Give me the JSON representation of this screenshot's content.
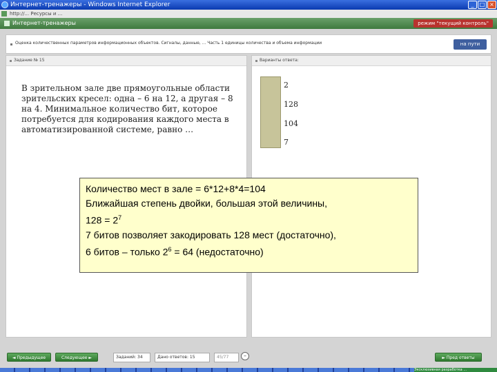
{
  "window": {
    "title": "Интернет-тренажеры - Windows Internet Explorer"
  },
  "address": {
    "url": "http://... Ресурсы и ..."
  },
  "app": {
    "name": "Интернет-тренажеры",
    "mode_label": "режим \"текущий контроль\""
  },
  "topic": {
    "text": "Оценка количественных параметров информационных объектов. Сигналы, данные, ... Часть 1 единицы количества и объема информации",
    "back_label": "на пути"
  },
  "question_panel": {
    "header": "Задание № 15",
    "text": "В зрительном зале две прямоугольные области зрительских кресел: одна – 6 на 12, а другая – 8 на 4. Минимальное количество бит, которое потребуется для кодирования каждого места в автоматизированной системе, равно …"
  },
  "answer_panel": {
    "header": "Варианты ответа:",
    "options": [
      "2",
      "128",
      "104",
      "7"
    ]
  },
  "explanation": {
    "line1": "Количество мест в зале = 6*12+8*4=104",
    "line2": "Ближайшая степень двойки, большая этой величины,",
    "line3_base": "128 = 2",
    "line3_exp": "7",
    "line4": "7 битов позволяет закодировать 128 мест (достаточно),",
    "line5_start": "6 битов – только 2",
    "line5_exp": "6",
    "line5_end": " = 64 (недостаточно)"
  },
  "bottom": {
    "prev_label": "◄ Предыдущее",
    "next_label": "Следующее ►",
    "tasks_label": "Заданий: 34",
    "done_label": "Дано ответов: 15",
    "pages_label": "45/77",
    "circle_label": "–",
    "finish_label": "► Пред ответы"
  },
  "taskbar": {
    "active_label": "Эксклюзивная разработка ..."
  }
}
